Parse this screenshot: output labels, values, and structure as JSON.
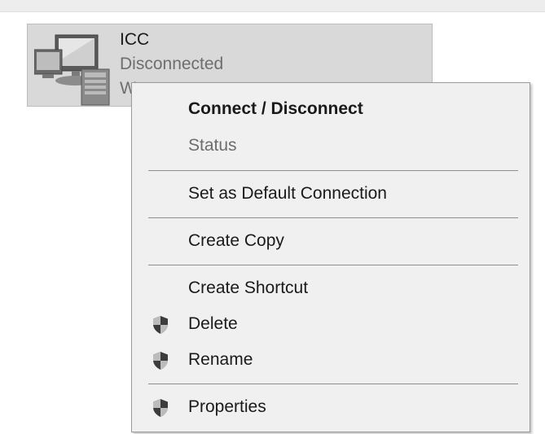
{
  "connection": {
    "name": "ICC",
    "status": "Disconnected",
    "device_partial": "W",
    "icon": "computer-icon"
  },
  "context_menu": {
    "items": [
      {
        "label": "Connect / Disconnect",
        "bold": true,
        "enabled": true,
        "icon": null
      },
      {
        "label": "Status",
        "bold": false,
        "enabled": false,
        "icon": null
      },
      {
        "label": "Set as Default Connection",
        "bold": false,
        "enabled": true,
        "icon": null
      },
      {
        "label": "Create Copy",
        "bold": false,
        "enabled": true,
        "icon": null
      },
      {
        "label": "Create Shortcut",
        "bold": false,
        "enabled": true,
        "icon": null
      },
      {
        "label": "Delete",
        "bold": false,
        "enabled": true,
        "icon": "uac-shield-icon"
      },
      {
        "label": "Rename",
        "bold": false,
        "enabled": true,
        "icon": "uac-shield-icon"
      },
      {
        "label": "Properties",
        "bold": false,
        "enabled": true,
        "icon": "uac-shield-icon"
      }
    ]
  }
}
